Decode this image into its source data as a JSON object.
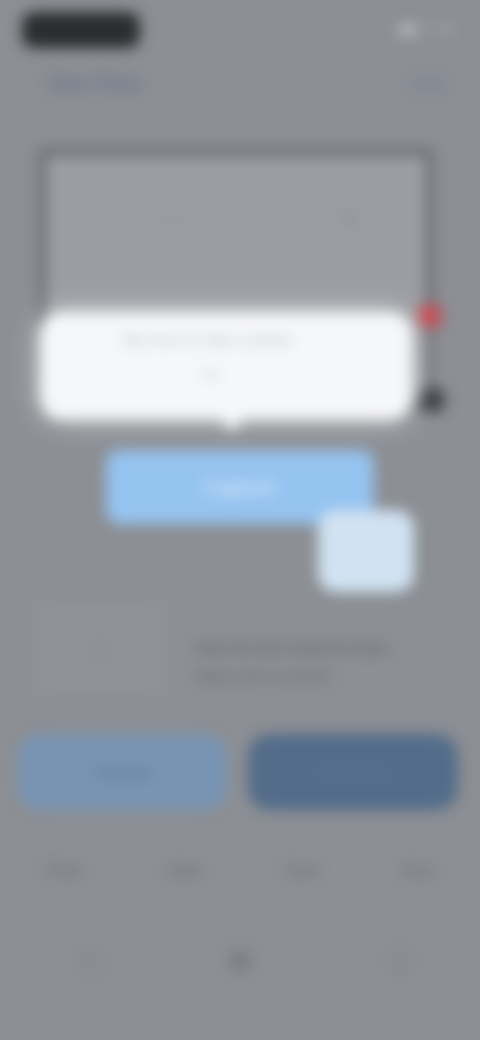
{
  "status_bar": {
    "time": "9:41",
    "icons": "▮▮ ◔ ▭"
  },
  "header": {
    "title": "Take Photo",
    "action": "Help"
  },
  "card": {
    "left_icon": "◌",
    "right_icon": "⌾"
  },
  "tooltip": {
    "line1": "Tap here to take a photo",
    "line2": "Tip"
  },
  "primary_button": {
    "label": "Capture"
  },
  "info": {
    "icon": "▢",
    "text1": "Place the item inside the frame",
    "text2": "Make sure it is well lit"
  },
  "buttons": {
    "left_label": "Retake",
    "right_label": "Continue"
  },
  "tabs": [
    "Photo",
    "Video",
    "Scan",
    "More"
  ],
  "nav_icons": [
    "home-icon",
    "camera-icon",
    "profile-icon"
  ],
  "colors": {
    "accent": "#95c3f0",
    "background": "#8c8f94",
    "flag": "#c84a52"
  }
}
